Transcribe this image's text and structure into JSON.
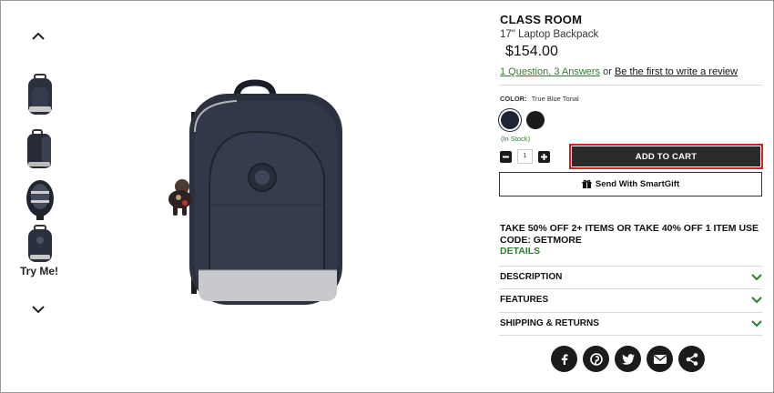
{
  "gallery": {
    "try_label": "Try Me!",
    "up_icon": "chevron-up-icon",
    "down_icon": "chevron-down-icon"
  },
  "product": {
    "title": "CLASS ROOM",
    "subtitle": "17\" Laptop Backpack",
    "price": "$154.00",
    "qa_link": "1 Question, 3 Answers",
    "qa_or": " or ",
    "review_link": "Be the first to write a review"
  },
  "color": {
    "label": "COLOR:",
    "selected": "True Blue Tonal",
    "swatches": [
      "navy",
      "black"
    ],
    "stock": "(In Stock)"
  },
  "quantity": {
    "value": "1"
  },
  "actions": {
    "add_to_cart": "ADD TO CART",
    "send_gift": "Send With SmartGift"
  },
  "promo": {
    "text": "TAKE 50% OFF 2+ ITEMS OR TAKE 40% OFF 1 ITEM USE CODE: GETMORE",
    "details": "DETAILS"
  },
  "accordion": [
    {
      "label": "DESCRIPTION"
    },
    {
      "label": "FEATURES"
    },
    {
      "label": "SHIPPING & RETURNS"
    }
  ],
  "social": [
    "facebook-icon",
    "pinterest-icon",
    "twitter-icon",
    "email-icon",
    "share-icon"
  ],
  "colors": {
    "accent_green": "#2f7d2f",
    "cart_bg": "#2b2b2b",
    "cart_outline": "#d62020"
  }
}
